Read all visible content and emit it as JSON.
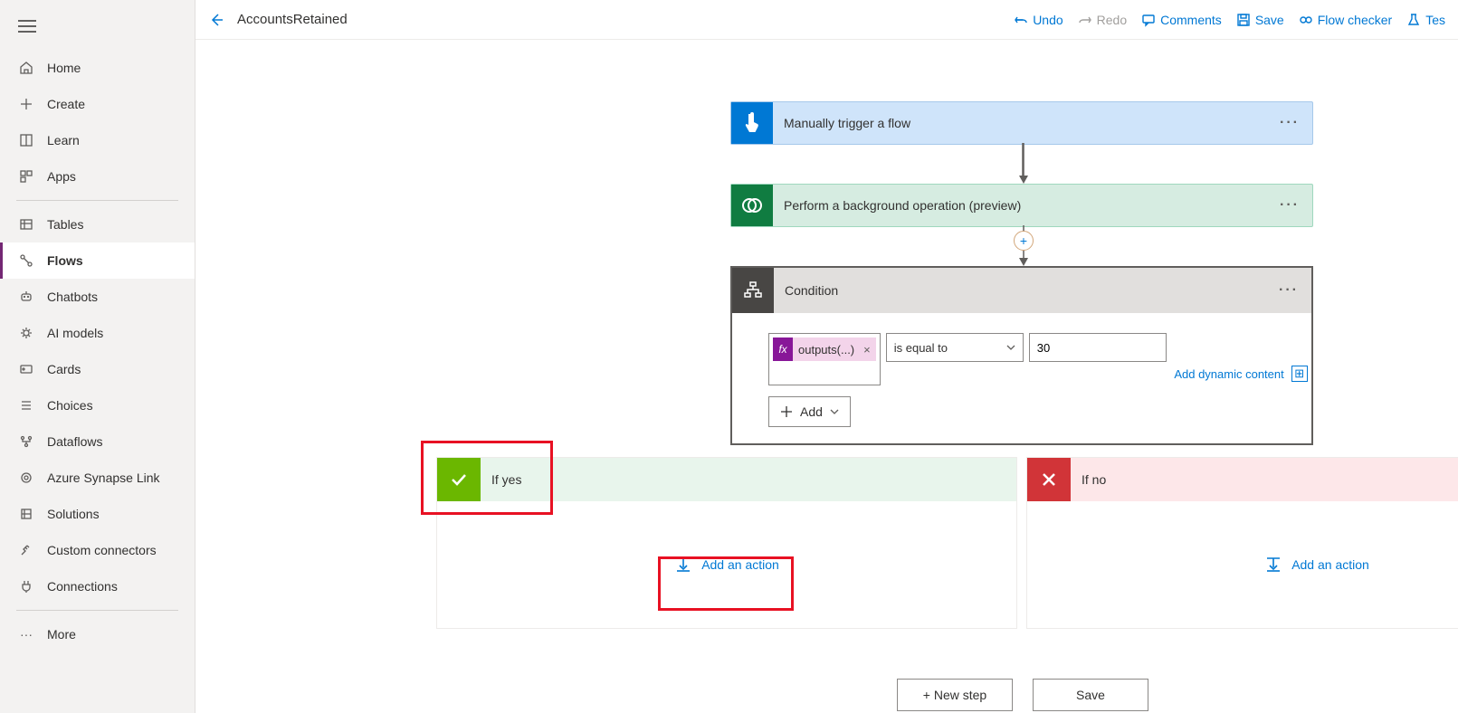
{
  "header": {
    "title": "AccountsRetained",
    "actions": {
      "undo": "Undo",
      "redo": "Redo",
      "comments": "Comments",
      "save": "Save",
      "flowchecker": "Flow checker",
      "test": "Tes"
    }
  },
  "sidebar": {
    "groups": [
      {
        "items": [
          {
            "id": "home",
            "label": "Home",
            "icon": "home-icon"
          },
          {
            "id": "create",
            "label": "Create",
            "icon": "plus-icon"
          },
          {
            "id": "learn",
            "label": "Learn",
            "icon": "book-icon"
          },
          {
            "id": "apps",
            "label": "Apps",
            "icon": "apps-icon"
          }
        ]
      },
      {
        "items": [
          {
            "id": "tables",
            "label": "Tables",
            "icon": "table-icon"
          },
          {
            "id": "flows",
            "label": "Flows",
            "icon": "flow-icon",
            "active": true
          },
          {
            "id": "chatbots",
            "label": "Chatbots",
            "icon": "chatbot-icon"
          },
          {
            "id": "aimodels",
            "label": "AI models",
            "icon": "ai-icon"
          },
          {
            "id": "cards",
            "label": "Cards",
            "icon": "card-icon"
          },
          {
            "id": "choices",
            "label": "Choices",
            "icon": "choices-icon"
          },
          {
            "id": "dataflows",
            "label": "Dataflows",
            "icon": "dataflow-icon"
          },
          {
            "id": "synapse",
            "label": "Azure Synapse Link",
            "icon": "synapse-icon"
          },
          {
            "id": "solutions",
            "label": "Solutions",
            "icon": "solutions-icon"
          },
          {
            "id": "connectors",
            "label": "Custom connectors",
            "icon": "connector-icon"
          },
          {
            "id": "connections",
            "label": "Connections",
            "icon": "plug-icon"
          }
        ]
      },
      {
        "items": [
          {
            "id": "more",
            "label": "More",
            "icon": "more-icon"
          }
        ]
      }
    ]
  },
  "flow": {
    "trigger": {
      "label": "Manually trigger a flow"
    },
    "bgop": {
      "label": "Perform a background operation (preview)"
    },
    "condition": {
      "label": "Condition",
      "expression_chip": "outputs(...)",
      "operator": "is equal to",
      "value": "30",
      "dynamic_link": "Add dynamic content",
      "add_label": "Add"
    },
    "branches": {
      "yes": {
        "label": "If yes",
        "add": "Add an action"
      },
      "no": {
        "label": "If no",
        "add": "Add an action"
      }
    },
    "buttons": {
      "newstep": "+ New step",
      "save": "Save"
    }
  }
}
